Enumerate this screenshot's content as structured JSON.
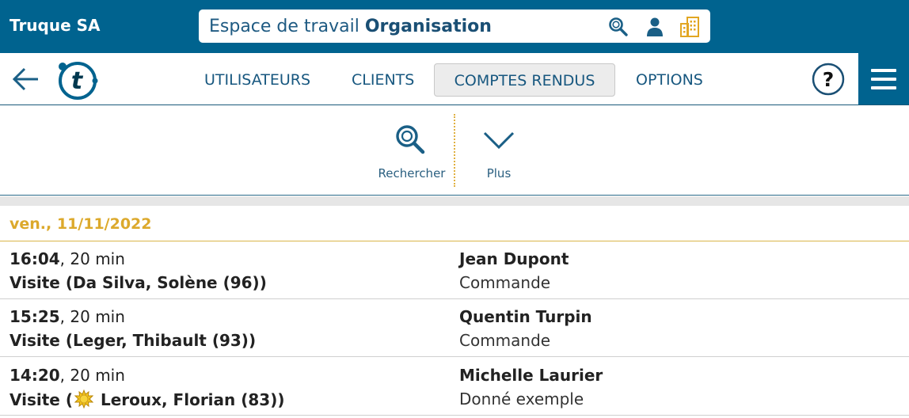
{
  "topbar": {
    "company": "Truque SA",
    "workspace_prefix": "Espace de travail",
    "workspace_name": "Organisation",
    "icons": [
      "search-icon",
      "user-icon",
      "building-icon"
    ],
    "background": "#00638f",
    "accent": "#e2a622"
  },
  "nav": {
    "items": [
      {
        "label": "UTILISATEURS"
      },
      {
        "label": "CLIENTS"
      },
      {
        "label": "COMPTES RENDUS",
        "active": true
      },
      {
        "label": "OPTIONS"
      }
    ],
    "help_label": "?"
  },
  "toolbar": {
    "search_label": "Rechercher",
    "more_label": "Plus"
  },
  "list": {
    "date": "ven., 11/11/2022",
    "rows": [
      {
        "time": "16:04",
        "duration": ", 20 min",
        "visit_prefix": "Visite (",
        "visit_detail": "Da Silva, Solène (96))",
        "contact": "Jean Dupont",
        "subject": "Commande"
      },
      {
        "time": "15:25",
        "duration": ", 20 min",
        "visit_prefix": "Visite (",
        "visit_detail": "Leger, Thibault (93))",
        "contact": "Quentin Turpin",
        "subject": "Commande"
      },
      {
        "time": "14:20",
        "duration": ", 20 min",
        "visit_prefix": "Visite (",
        "visit_detail": " Leroux, Florian (83))",
        "contact": "Michelle Laurier",
        "subject": "Donné exemple",
        "badge_icon": "sun-icon"
      }
    ]
  }
}
